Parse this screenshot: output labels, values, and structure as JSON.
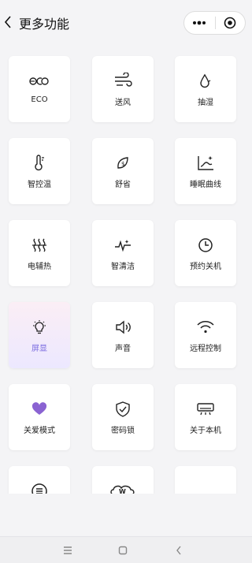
{
  "header": {
    "title": "更多功能"
  },
  "functions": [
    {
      "id": "eco",
      "label": "ECO",
      "icon": "eco-icon"
    },
    {
      "id": "fan",
      "label": "送风",
      "icon": "wind-icon"
    },
    {
      "id": "dehumidify",
      "label": "抽湿",
      "icon": "water-drop-icon"
    },
    {
      "id": "smart-temp",
      "label": "智控温",
      "icon": "thermometer-icon"
    },
    {
      "id": "save",
      "label": "舒省",
      "icon": "leaf-icon"
    },
    {
      "id": "sleep-curve",
      "label": "睡眠曲线",
      "icon": "sleep-curve-icon"
    },
    {
      "id": "aux-heat",
      "label": "电辅热",
      "icon": "heater-icon"
    },
    {
      "id": "smart-clean",
      "label": "智清洁",
      "icon": "sparkle-clean-icon"
    },
    {
      "id": "timer-off",
      "label": "预约关机",
      "icon": "clock-icon"
    },
    {
      "id": "display",
      "label": "屏显",
      "icon": "bulb-icon",
      "active": true
    },
    {
      "id": "sound",
      "label": "声音",
      "icon": "speaker-icon"
    },
    {
      "id": "remote",
      "label": "远程控制",
      "icon": "wifi-icon"
    },
    {
      "id": "care-mode",
      "label": "关爱模式",
      "icon": "heart-icon"
    },
    {
      "id": "lock",
      "label": "密码锁",
      "icon": "shield-check-icon"
    },
    {
      "id": "about",
      "label": "关于本机",
      "icon": "air-conditioner-icon"
    },
    {
      "id": "menu",
      "label": "",
      "icon": "list-circle-icon"
    },
    {
      "id": "w-mode",
      "label": "",
      "icon": "w-cloud-icon"
    },
    {
      "id": "empty",
      "label": "",
      "icon": ""
    }
  ],
  "colors": {
    "accent": "#7a6be0",
    "heart": "#8a63d2",
    "active_tile_top": "#fbeef5",
    "active_tile_bottom": "#ece8ff"
  }
}
